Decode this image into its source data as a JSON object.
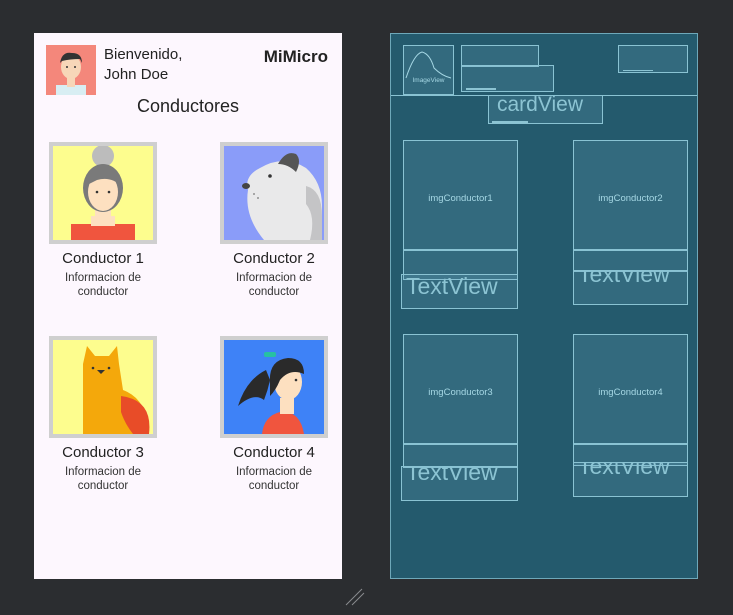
{
  "header": {
    "greeting_line1": "Bienvenido,",
    "greeting_line2": "John Doe",
    "brand": "MiMicro"
  },
  "screen_title": "Conductores",
  "cards": [
    {
      "name": "Conductor 1",
      "info_line1": "Informacion de",
      "info_line2": "conductor",
      "image": "woman-grey-bun",
      "bg": "#fdfd8e"
    },
    {
      "name": "Conductor 2",
      "info_line1": "Informacion de",
      "info_line2": "conductor",
      "image": "dog-profile",
      "bg": "#8a9cf9"
    },
    {
      "name": "Conductor 3",
      "info_line1": "Informacion de",
      "info_line2": "conductor",
      "image": "orange-cat",
      "bg": "#fdfd8e"
    },
    {
      "name": "Conductor 4",
      "info_line1": "Informacion de",
      "info_line2": "conductor",
      "image": "woman-ponytail",
      "bg": "#3e82f7"
    }
  ],
  "blueprint": {
    "imageview_label": "ImageView",
    "cardview_label": "cardView",
    "img_labels": [
      "imgConductor1",
      "imgConductor2",
      "imgConductor3",
      "imgConductor4"
    ],
    "textview_label": "TextView"
  },
  "colors": {
    "canvas": "#2b2d30",
    "screen_bg": "#fdf7fe",
    "blueprint_bg": "#245a6d",
    "blueprint_line": "#8ac3d3"
  }
}
